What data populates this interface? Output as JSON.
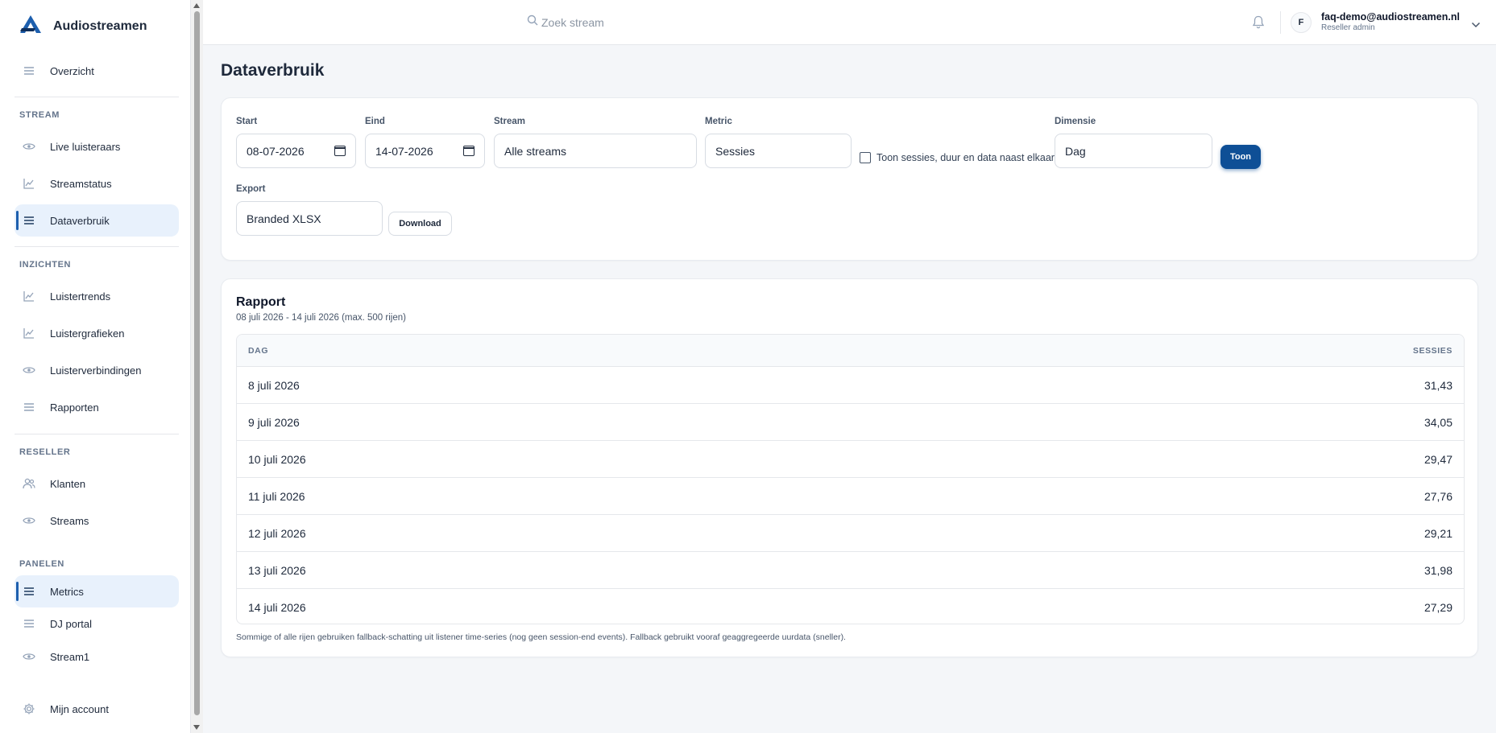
{
  "app": {
    "name": "Audiostreamen",
    "brand_color": "#1d5fae"
  },
  "sidebar": {
    "top": [
      {
        "label": "Overzicht",
        "icon": "menu-lines-icon"
      }
    ],
    "sections": [
      {
        "label": "STREAM",
        "items": [
          {
            "label": "Live luisteraars",
            "icon": "eye-icon"
          },
          {
            "label": "Streamstatus",
            "icon": "chart-line-icon"
          },
          {
            "label": "Dataverbruik",
            "icon": "menu-lines-icon",
            "active": true
          }
        ]
      },
      {
        "label": "INZICHTEN",
        "items": [
          {
            "label": "Luistertrends",
            "icon": "chart-line-icon"
          },
          {
            "label": "Luistergrafieken",
            "icon": "chart-line-icon"
          },
          {
            "label": "Luisterverbindingen",
            "icon": "eye-icon"
          },
          {
            "label": "Rapporten",
            "icon": "menu-lines-icon"
          }
        ]
      },
      {
        "label": "RESELLER",
        "items": [
          {
            "label": "Klanten",
            "icon": "users-icon"
          },
          {
            "label": "Streams",
            "icon": "eye-icon"
          }
        ]
      },
      {
        "label": "PANELEN",
        "items": [
          {
            "label": "Metrics",
            "icon": "menu-lines-icon",
            "active": true
          },
          {
            "label": "DJ portal",
            "icon": "menu-lines-icon"
          },
          {
            "label": "Stream1",
            "icon": "eye-icon"
          }
        ]
      }
    ],
    "account": {
      "label": "Mijn account",
      "icon": "gear-icon"
    }
  },
  "header": {
    "search_placeholder": "Zoek stream",
    "avatar_initial": "F",
    "user_email": "faq-demo@audiostreamen.nl",
    "user_role": "Reseller admin"
  },
  "page": {
    "title": "Dataverbruik"
  },
  "filters": {
    "start_label": "Start",
    "start_value": "08-07-2026",
    "end_label": "Eind",
    "end_value": "14-07-2026",
    "stream_label": "Stream",
    "stream_value": "Alle streams",
    "metric_label": "Metric",
    "metric_value": "Sessies",
    "checkbox_label": "Toon sessies, duur en data naast elkaar",
    "checkbox_checked": false,
    "dimension_label": "Dimensie",
    "dimension_value": "Dag",
    "show_button": "Toon",
    "export_label": "Export",
    "export_value": "Branded XLSX",
    "download_button": "Download"
  },
  "report": {
    "title": "Rapport",
    "subtitle": "08 juli 2026 - 14 juli 2026 (max. 500 rijen)",
    "columns": [
      "DAG",
      "SESSIES"
    ],
    "rows": [
      {
        "day": "8 juli 2026",
        "value": "31,43"
      },
      {
        "day": "9 juli 2026",
        "value": "34,05"
      },
      {
        "day": "10 juli 2026",
        "value": "29,47"
      },
      {
        "day": "11 juli 2026",
        "value": "27,76"
      },
      {
        "day": "12 juli 2026",
        "value": "29,21"
      },
      {
        "day": "13 juli 2026",
        "value": "31,98"
      },
      {
        "day": "14 juli 2026",
        "value": "27,29"
      }
    ],
    "footnote": "Sommige of alle rijen gebruiken fallback-schatting uit listener time-series (nog geen session-end events). Fallback gebruikt vooraf geaggregeerde uurdata (sneller)."
  }
}
